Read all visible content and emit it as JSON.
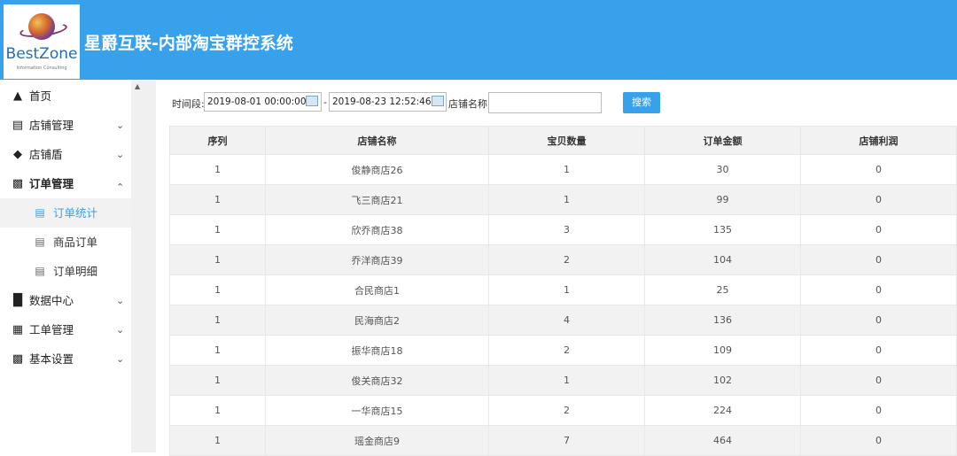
{
  "header": {
    "logo_text": "BestZone",
    "logo_sub": "Information Consulting",
    "title": "星爵互联-内部淘宝群控系统",
    "bg_color": "#37a1ec"
  },
  "sidebar": {
    "items": [
      {
        "icon": "home-icon",
        "label": "首页"
      },
      {
        "icon": "store-icon",
        "label": "店铺管理"
      },
      {
        "icon": "shield-icon",
        "label": "店铺盾"
      },
      {
        "icon": "order-icon",
        "label": "订单管理"
      },
      {
        "icon": "list-icon",
        "label": "订单统计"
      },
      {
        "icon": "list-icon",
        "label": "商品订单"
      },
      {
        "icon": "list-icon",
        "label": "订单明细"
      },
      {
        "icon": "bar-chart-icon",
        "label": "数据中心"
      },
      {
        "icon": "document-icon",
        "label": "工单管理"
      },
      {
        "icon": "settings-icon",
        "label": "基本设置"
      }
    ]
  },
  "filter": {
    "time_label": "时间段:",
    "start": "2019-08-01 00:00:00",
    "separator": "-",
    "end": "2019-08-23 12:52:46",
    "shop_label": "店铺名称:",
    "shop_value": "",
    "search_label": "搜索"
  },
  "table": {
    "headers": [
      "序列",
      "店铺名称",
      "宝贝数量",
      "订单金额",
      "店铺利润"
    ],
    "rows": [
      [
        "1",
        "俊静商店26",
        "1",
        "30",
        "0"
      ],
      [
        "1",
        "飞三商店21",
        "1",
        "99",
        "0"
      ],
      [
        "1",
        "欣乔商店38",
        "3",
        "135",
        "0"
      ],
      [
        "1",
        "乔洋商店39",
        "2",
        "104",
        "0"
      ],
      [
        "1",
        "合民商店1",
        "1",
        "25",
        "0"
      ],
      [
        "1",
        "民海商店2",
        "4",
        "136",
        "0"
      ],
      [
        "1",
        "振华商店18",
        "2",
        "109",
        "0"
      ],
      [
        "1",
        "俊关商店32",
        "1",
        "102",
        "0"
      ],
      [
        "1",
        "一华商店15",
        "2",
        "224",
        "0"
      ],
      [
        "1",
        "瑶金商店9",
        "7",
        "464",
        "0"
      ]
    ]
  }
}
